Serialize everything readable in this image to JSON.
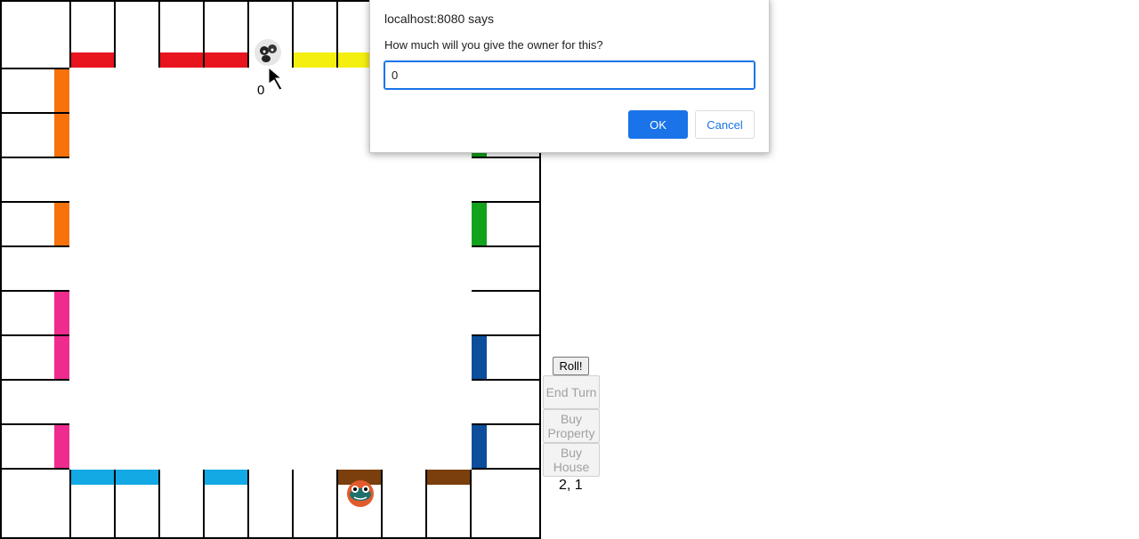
{
  "dialog": {
    "title": "localhost:8080 says",
    "message": "How much will you give the owner for this?",
    "input_value": "0",
    "ok_label": "OK",
    "cancel_label": "Cancel"
  },
  "controls": {
    "roll_label": "Roll!",
    "end_turn_label": "End Turn",
    "buy_property_label": "Buy Property",
    "buy_house_label": "Buy House",
    "coords_text": "2, 1"
  },
  "board": {
    "player_money": "0",
    "colors": {
      "red": "#e8141e",
      "yellow": "#f5ef10",
      "orange": "#f7720b",
      "pink": "#ef2b8f",
      "green": "#12a21c",
      "blue": "#0c4e9c",
      "light_blue": "#12a9e4",
      "brown": "#7a3f0c"
    },
    "tokens": [
      "dog-token-icon",
      "frog-token-icon"
    ]
  }
}
